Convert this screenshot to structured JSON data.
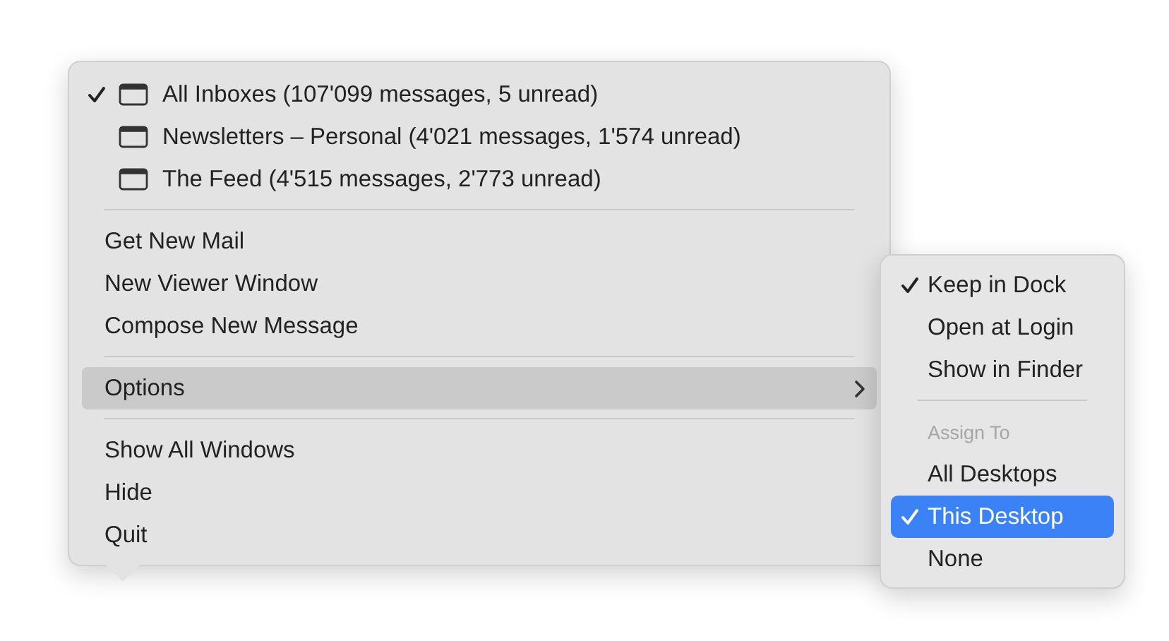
{
  "menu": {
    "sections": [
      {
        "items": [
          {
            "kind": "window",
            "label": "All Inboxes (107'099 messages, 5 unread)",
            "checked": true,
            "selected": false
          },
          {
            "kind": "window",
            "label": "Newsletters – Personal (4'021 messages, 1'574 unread)",
            "checked": false,
            "selected": false
          },
          {
            "kind": "window",
            "label": "The Feed (4'515 messages, 2'773 unread)",
            "checked": false,
            "selected": false
          }
        ]
      },
      {
        "items": [
          {
            "kind": "command",
            "label": "Get New Mail",
            "selected": false
          },
          {
            "kind": "command",
            "label": "New Viewer Window",
            "selected": false
          },
          {
            "kind": "command",
            "label": "Compose New Message",
            "selected": false
          }
        ]
      },
      {
        "items": [
          {
            "kind": "submenu",
            "label": "Options",
            "selected": true
          }
        ]
      },
      {
        "items": [
          {
            "kind": "command",
            "label": "Show All Windows",
            "selected": false
          },
          {
            "kind": "command",
            "label": "Hide",
            "selected": false
          },
          {
            "kind": "command",
            "label": "Quit",
            "selected": false
          }
        ]
      }
    ]
  },
  "submenu": {
    "sections": [
      {
        "items": [
          {
            "kind": "command",
            "label": "Keep in Dock",
            "checked": true,
            "selected": false
          },
          {
            "kind": "command",
            "label": "Open at Login",
            "checked": false,
            "selected": false
          },
          {
            "kind": "command",
            "label": "Show in Finder",
            "checked": false,
            "selected": false
          }
        ]
      },
      {
        "items": [
          {
            "kind": "heading",
            "label": "Assign To"
          },
          {
            "kind": "command",
            "label": "All Desktops",
            "checked": false,
            "selected": false
          },
          {
            "kind": "command",
            "label": "This Desktop",
            "checked": true,
            "selected": true
          },
          {
            "kind": "command",
            "label": "None",
            "checked": false,
            "selected": false
          }
        ]
      }
    ]
  }
}
